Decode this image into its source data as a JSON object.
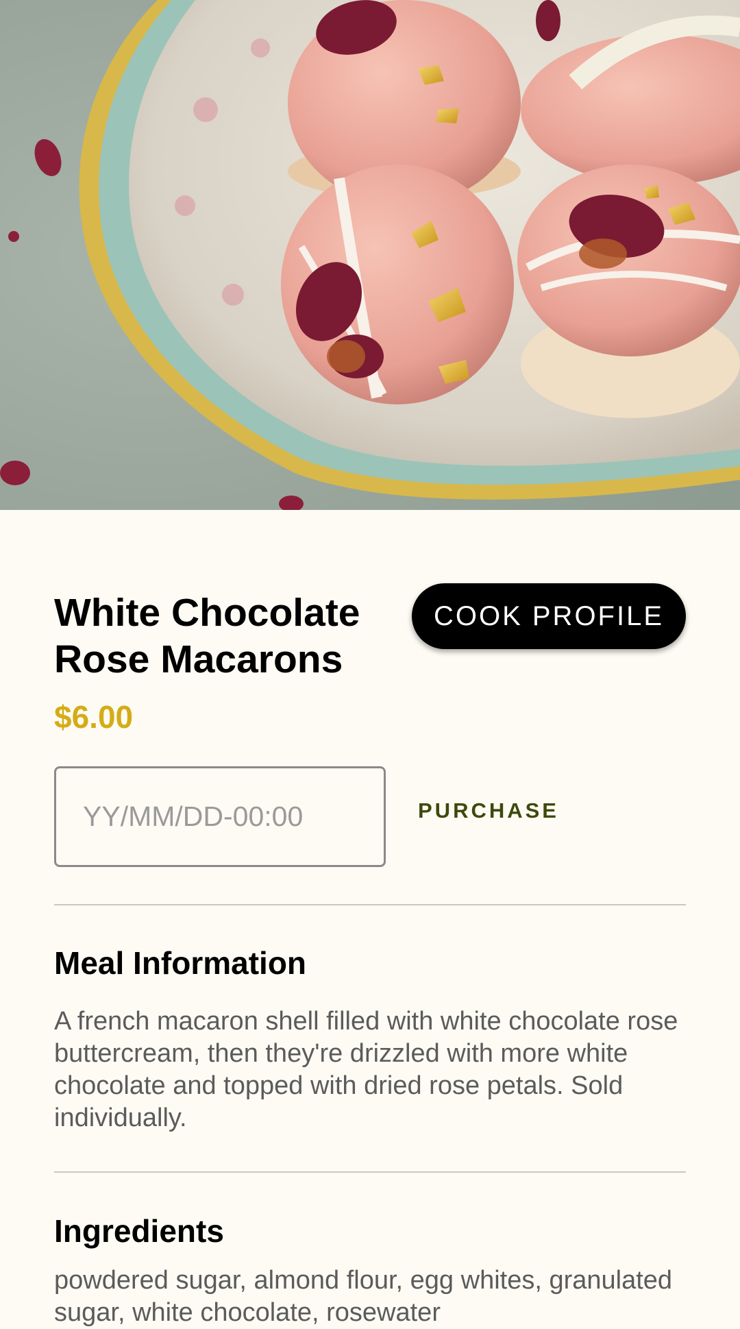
{
  "product": {
    "title": "White Chocolate Rose Macarons",
    "price": "$6.00",
    "cook_profile_label": "COOK PROFILE",
    "date_placeholder": "YY/MM/DD-00:00",
    "date_value": "",
    "purchase_label": "PURCHASE"
  },
  "sections": {
    "meal_info": {
      "title": "Meal Information",
      "text": "A french macaron shell filled with white chocolate rose buttercream, then they're drizzled with more white chocolate and topped with dried rose petals. Sold individually."
    },
    "ingredients": {
      "title": "Ingredients",
      "text": "powdered sugar, almond flour, egg whites, granulated sugar, white chocolate, rosewater"
    }
  },
  "colors": {
    "background": "#fdfbf4",
    "price_accent": "#d4ac16",
    "purchase_text": "#3d4a0c",
    "cook_button": "#000000"
  },
  "hero_image": {
    "subject": "pink macarons with white chocolate drizzle, gold leaf and dried rose petals on a floral porcelain plate"
  }
}
